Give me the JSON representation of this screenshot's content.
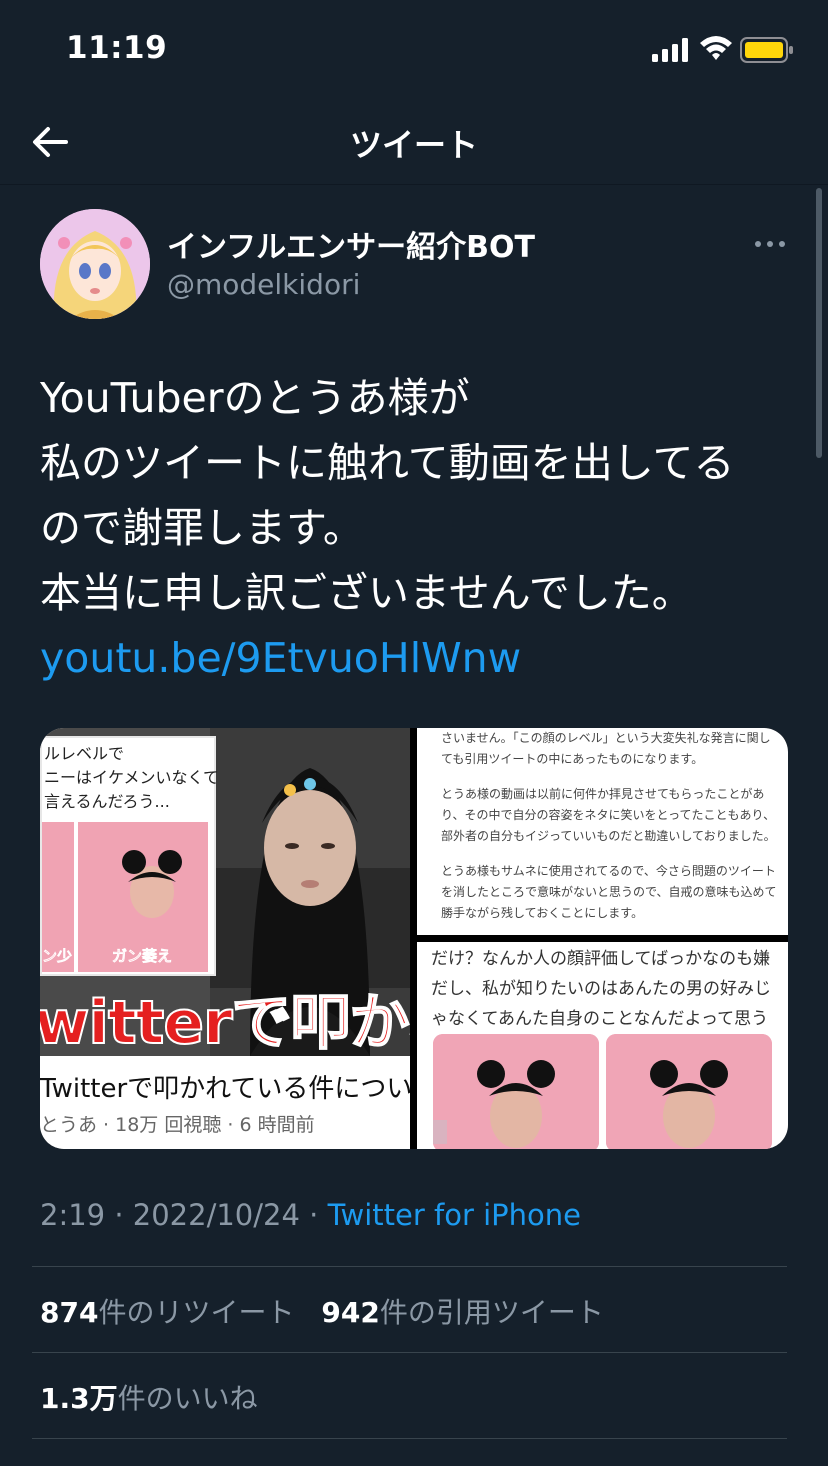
{
  "status_bar": {
    "time": "11:19"
  },
  "nav": {
    "title": "ツイート"
  },
  "author": {
    "display_name": "インフルエンサー紹介BOT",
    "handle": "@modelkidori"
  },
  "tweet": {
    "lines": [
      "YouTuberのとうあ様が",
      "私のツイートに触れて動画を出してる",
      "ので謝罪します。",
      "本当に申し訳ございませんでした。"
    ],
    "link": "youtu.be/9EtvuoHlWnw"
  },
  "media": {
    "video": {
      "inset_text": "ルレベルで\nニーはイケメンいなくて\n言えるんだろう...",
      "caption_left": "ン少",
      "caption_right": "ガン萎え",
      "big_text": "witterで叩かれ",
      "title": "Twitterで叩かれている件につい",
      "meta": "とうあ · 18万 回視聴 · 6 時間前"
    },
    "doc_top": [
      "さいません。「この顔のレベル」という大変失礼な発言に関しても引用ツイートの中にあったものになります。",
      "とうあ様の動画は以前に何件か拝見させてもらったことがあり、その中で自分の容姿をネタに笑いをとってたこともあり、部外者の自分もイジっていいものだと勘違いしておりました。",
      "とうあ様もサムネに使用されてるので、今さら問題のツイートを消したところで意味がないと思うので、自戒の意味も込めて勝手ながら残しておくことにします。"
    ],
    "doc_bottom": "だけ？なんか人の顔評価してばっかなのも嫌だし、私が知りたいのはあんたの男の好みじゃなくてあんた自身のことなんだよって思う"
  },
  "meta": {
    "time": "2:19",
    "sep": " · ",
    "date": "2022/10/24",
    "source": "Twitter for iPhone"
  },
  "stats": {
    "retweets_count": "874",
    "retweets_label": "件のリツイート",
    "quotes_count": "942",
    "quotes_label": "件の引用ツイート",
    "likes_count": "1.3万",
    "likes_label": "件のいいね"
  },
  "colors": {
    "background": "#15202b",
    "link": "#1d9bf0",
    "secondary_text": "#8b98a5",
    "battery": "#ffd60a"
  },
  "icons": [
    "back-arrow-icon",
    "more-icon",
    "signal-icon",
    "wifi-icon",
    "battery-icon"
  ]
}
